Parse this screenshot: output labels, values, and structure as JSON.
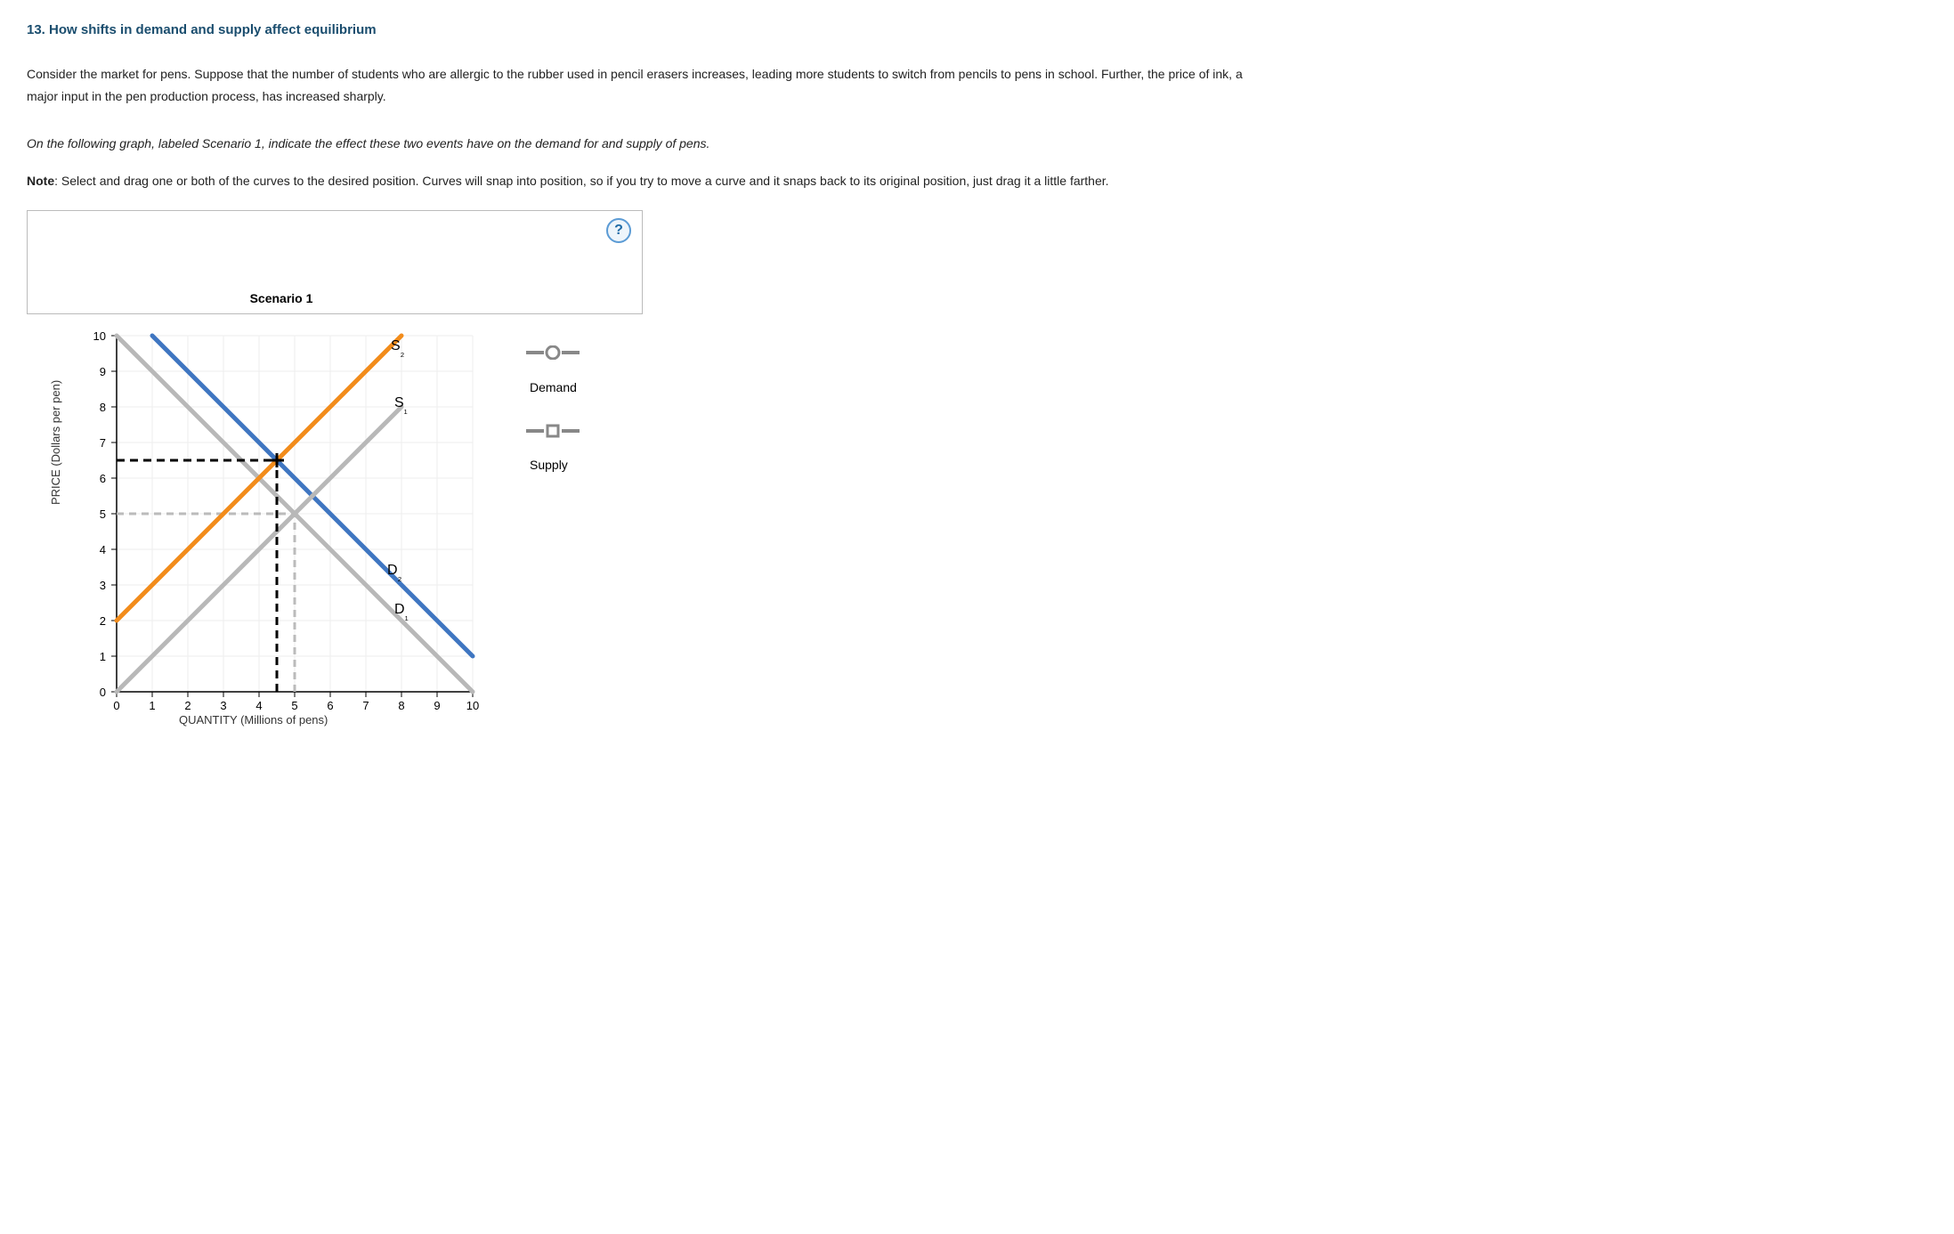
{
  "question": {
    "number": "13.",
    "title": "How shifts in demand and supply affect equilibrium"
  },
  "prompt": "Consider the market for pens. Suppose that the number of students who are allergic to the rubber used in pencil erasers increases, leading more students to switch from pencils to pens in school. Further, the price of ink, a major input in the pen production process, has increased sharply.",
  "instruction": "On the following graph, labeled Scenario 1, indicate the effect these two events have on the demand for and supply of pens.",
  "note_label": "Note",
  "note_body": ": Select and drag one or both of the curves to the desired position. Curves will snap into position, so if you try to move a curve and it snaps back to its original position, just drag it a little farther.",
  "help_icon": "?",
  "legend": {
    "demand": "Demand",
    "supply": "Supply"
  },
  "chart_data": {
    "type": "line",
    "title": "Scenario 1",
    "xlabel": "QUANTITY (Millions of pens)",
    "ylabel": "PRICE (Dollars per pen)",
    "xlim": [
      0,
      10
    ],
    "ylim": [
      0,
      10
    ],
    "xticks": [
      0,
      1,
      2,
      3,
      4,
      5,
      6,
      7,
      8,
      9,
      10
    ],
    "yticks": [
      0,
      1,
      2,
      3,
      4,
      5,
      6,
      7,
      8,
      9,
      10
    ],
    "series": [
      {
        "name": "D1",
        "label": "D₁",
        "color": "#b8b8b8",
        "x": [
          0,
          10
        ],
        "y": [
          10,
          0
        ]
      },
      {
        "name": "D2",
        "label": "D₂",
        "color": "#3f76c1",
        "x": [
          1,
          10
        ],
        "y": [
          10,
          1
        ]
      },
      {
        "name": "S1",
        "label": "S₁",
        "color": "#b8b8b8",
        "x": [
          0,
          8
        ],
        "y": [
          0,
          8
        ]
      },
      {
        "name": "S2",
        "label": "S₂",
        "color": "#f28c1b",
        "x": [
          0,
          8
        ],
        "y": [
          2,
          10
        ]
      }
    ],
    "curve_label_pos": {
      "D1": {
        "x": 7.6,
        "y": 2.2
      },
      "D2": {
        "x": 7.4,
        "y": 3.3
      },
      "S1": {
        "x": 7.6,
        "y": 8.0
      },
      "S2": {
        "x": 7.5,
        "y": 9.6
      }
    },
    "original_equilibrium": {
      "x": 5,
      "y": 5
    },
    "new_equilibrium": {
      "x": 4.5,
      "y": 6.5
    }
  }
}
